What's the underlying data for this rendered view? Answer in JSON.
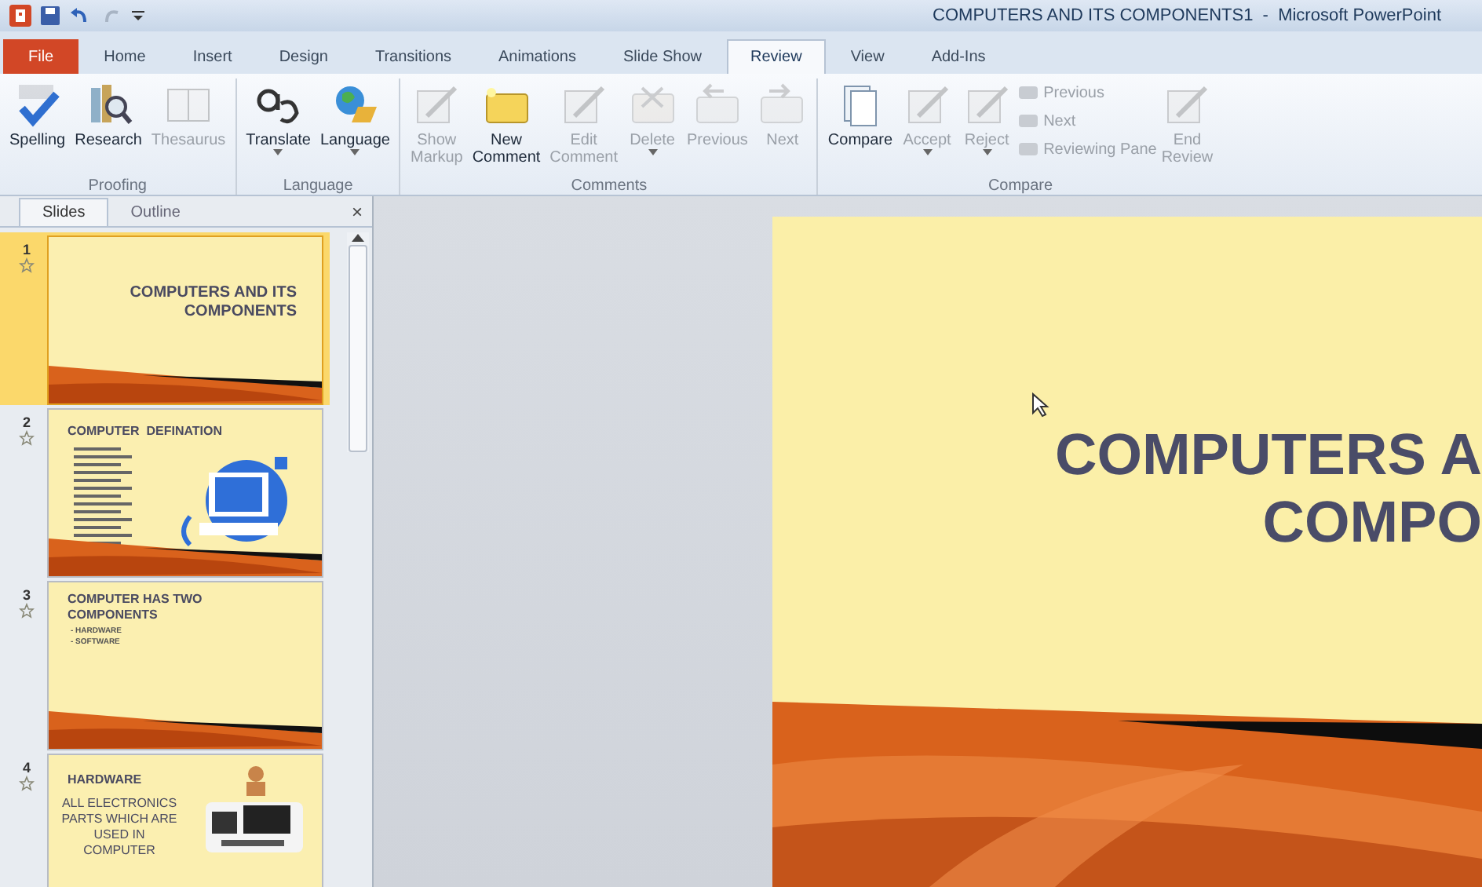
{
  "window": {
    "title": "COMPUTERS AND ITS COMPONENTS1  -  Microsoft PowerPoint"
  },
  "ribbon_tabs": [
    {
      "label": "File",
      "kind": "file",
      "selected": false
    },
    {
      "label": "Home",
      "kind": "tab",
      "selected": false
    },
    {
      "label": "Insert",
      "kind": "tab",
      "selected": false
    },
    {
      "label": "Design",
      "kind": "tab",
      "selected": false
    },
    {
      "label": "Transitions",
      "kind": "tab",
      "selected": false
    },
    {
      "label": "Animations",
      "kind": "tab",
      "selected": false
    },
    {
      "label": "Slide Show",
      "kind": "tab",
      "selected": false
    },
    {
      "label": "Review",
      "kind": "tab",
      "selected": true
    },
    {
      "label": "View",
      "kind": "tab",
      "selected": false
    },
    {
      "label": "Add-Ins",
      "kind": "tab",
      "selected": false
    }
  ],
  "ribbon_groups": [
    {
      "label": "Proofing",
      "buttons": [
        {
          "kind": "large",
          "label": "Spelling",
          "disabled": false,
          "dropdown": false
        },
        {
          "kind": "large",
          "label": "Research",
          "disabled": false,
          "dropdown": false
        },
        {
          "kind": "large",
          "label": "Thesaurus",
          "disabled": true,
          "dropdown": false
        }
      ]
    },
    {
      "label": "Language",
      "buttons": [
        {
          "kind": "large",
          "label": "Translate",
          "disabled": false,
          "dropdown": true
        },
        {
          "kind": "large",
          "label": "Language",
          "disabled": false,
          "dropdown": true
        }
      ]
    },
    {
      "label": "Comments",
      "buttons": [
        {
          "kind": "large",
          "label": "Show Markup",
          "disabled": true,
          "dropdown": false
        },
        {
          "kind": "large",
          "label": "New Comment",
          "disabled": false,
          "dropdown": false
        },
        {
          "kind": "large",
          "label": "Edit Comment",
          "disabled": true,
          "dropdown": false
        },
        {
          "kind": "large",
          "label": "Delete",
          "disabled": true,
          "dropdown": true
        },
        {
          "kind": "large",
          "label": "Previous",
          "disabled": true,
          "dropdown": false
        },
        {
          "kind": "large",
          "label": "Next",
          "disabled": true,
          "dropdown": false
        }
      ]
    },
    {
      "label": "Compare",
      "buttons": [
        {
          "kind": "large",
          "label": "Compare",
          "disabled": false,
          "dropdown": false
        },
        {
          "kind": "large",
          "label": "Accept",
          "disabled": true,
          "dropdown": true
        },
        {
          "kind": "large",
          "label": "Reject",
          "disabled": true,
          "dropdown": true
        },
        {
          "kind": "small",
          "label": "Previous",
          "disabled": true,
          "dropdown": false
        },
        {
          "kind": "small",
          "label": "Next",
          "disabled": true,
          "dropdown": false
        },
        {
          "kind": "small",
          "label": "Reviewing Pane",
          "disabled": true,
          "dropdown": false
        },
        {
          "kind": "large",
          "label": "End Review",
          "disabled": true,
          "dropdown": false
        }
      ]
    }
  ],
  "pane_tabs": [
    {
      "label": "Slides",
      "selected": true
    },
    {
      "label": "Outline",
      "selected": false
    }
  ],
  "pane_close": "×",
  "thumbnails": [
    {
      "number": "1",
      "selected": true,
      "kind": "title",
      "title": "COMPUTERS AND ITS COMPONENTS"
    },
    {
      "number": "2",
      "selected": false,
      "kind": "definition",
      "title": "COMPUTER  DEFINATION"
    },
    {
      "number": "3",
      "selected": false,
      "kind": "list",
      "title": "COMPUTER HAS TWO COMPONENTS",
      "bullets": [
        "- HARDWARE",
        "- SOFTWARE"
      ]
    },
    {
      "number": "4",
      "selected": false,
      "kind": "hardware",
      "title": "HARDWARE",
      "body": "ALL ELECTRONICS PARTS WHICH ARE USED IN COMPUTER"
    }
  ],
  "slide": {
    "title_lines": [
      "COMPUTERS A",
      "COMPO"
    ]
  }
}
